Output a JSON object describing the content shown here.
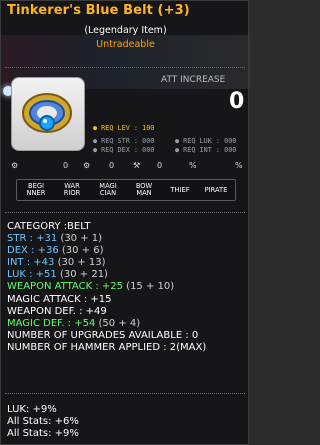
{
  "item": {
    "name": "Tinkerer's Blue Belt (+3)",
    "grade": "(Legendary Item)",
    "tradeability": "Untradeable",
    "att_increase_label": "ATT INCREASE",
    "att_increase_value": "0"
  },
  "requirements": {
    "lev": "● REQ LEV : 100",
    "str": "● REQ STR : 000",
    "luk": "● REQ LUK : 000",
    "dex": "● REQ DEX : 000",
    "int": "● REQ INT : 000"
  },
  "small_indicators": [
    "0",
    "0",
    "0",
    "%",
    "%"
  ],
  "jobs": [
    {
      "label": "BEGI\nNNER"
    },
    {
      "label": "WAR\nRIOR"
    },
    {
      "label": "MAGI\nCIAN"
    },
    {
      "label": "BOW\nMAN"
    },
    {
      "label": "THIEF"
    },
    {
      "label": "PIRATE"
    }
  ],
  "stats": {
    "category": "CATEGORY :BELT",
    "str": {
      "label": "STR : +31",
      "detail": "(30 + 1)"
    },
    "dex": {
      "label": "DEX : +36",
      "detail": "(30 + 6)"
    },
    "int": {
      "label": "INT : +43",
      "detail": "(30 + 13)"
    },
    "luk": {
      "label": "LUK : +51",
      "detail": "(30 + 21)"
    },
    "weapon_attack": {
      "label": "WEAPON ATTACK : +25",
      "detail": "(15 + 10)"
    },
    "magic_attack": "MAGIC ATTACK : +15",
    "weapon_def": "WEAPON DEF. : +49",
    "magic_def": {
      "label": "MAGIC DEF. : +54",
      "detail": "(50 + 4)"
    },
    "upgrades": "NUMBER OF UPGRADES AVAILABLE : 0",
    "hammer": "NUMBER OF HAMMER APPLIED : 2(MAX)"
  },
  "potential": {
    "lines": [
      "LUK: +9%",
      "All Stats: +6%",
      "All Stats: +9%"
    ]
  },
  "colors": {
    "title": "#ffb31f",
    "untradeable": "#ffa400",
    "blue_stat": "#67c6ff",
    "green_stat": "#5cff6a"
  }
}
